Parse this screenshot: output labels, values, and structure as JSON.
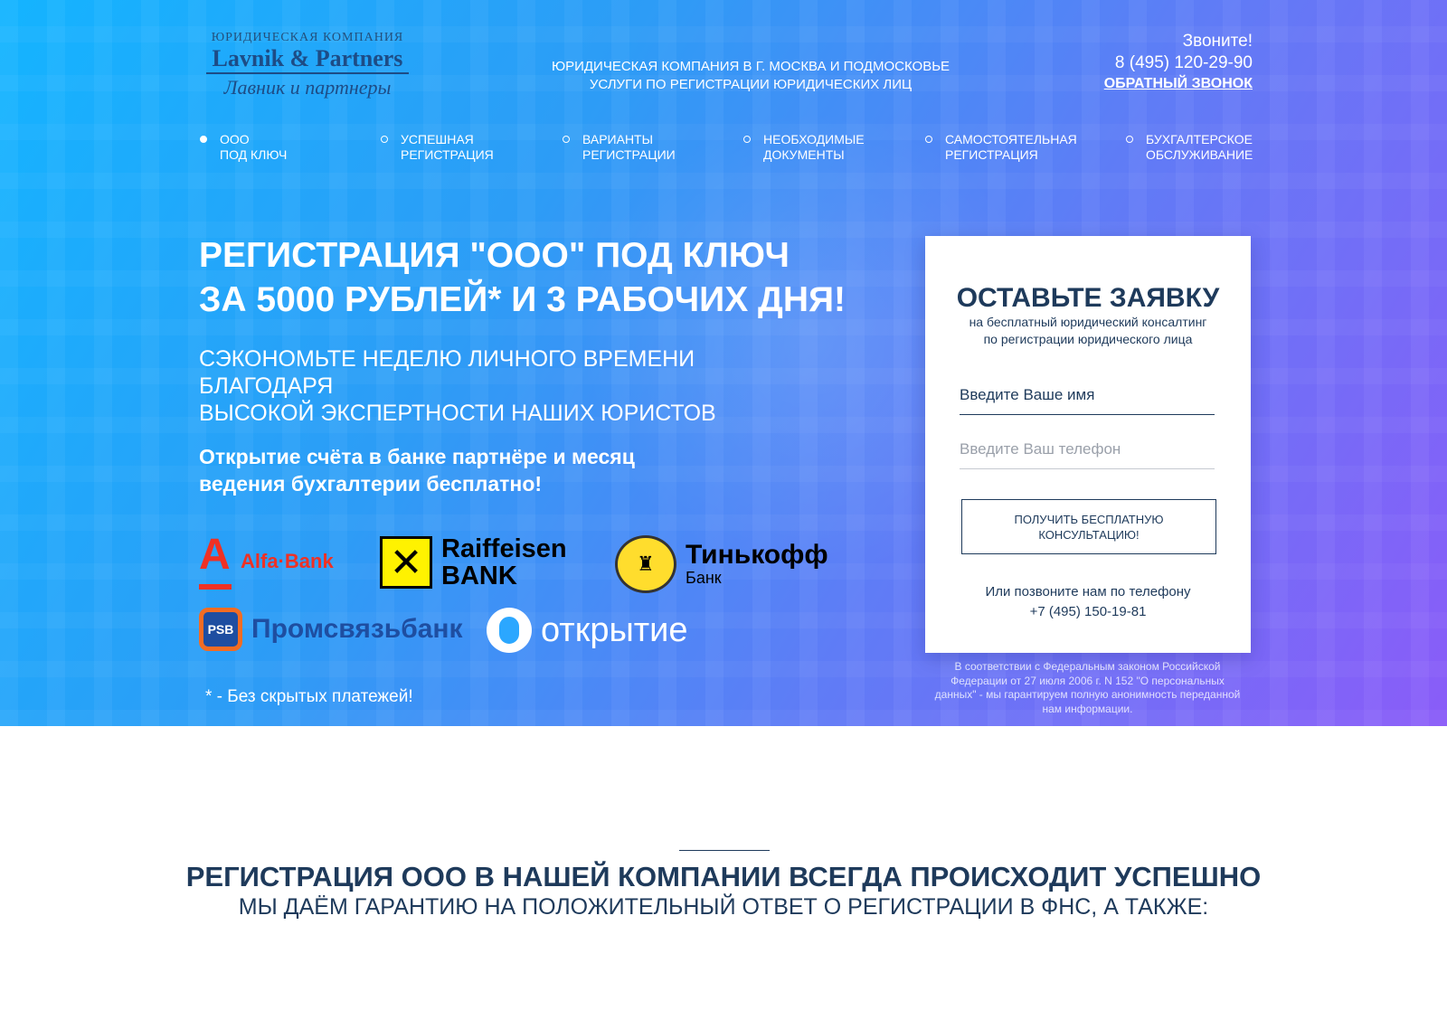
{
  "header": {
    "logo": {
      "top": "ЮРИДИЧЕСКАЯ КОМПАНИЯ",
      "main": "Lavnik & Partners",
      "sub": "Лавник и партнеры"
    },
    "tagline_1": "ЮРИДИЧЕСКАЯ КОМПАНИЯ В Г. МОСКВА И ПОДМОСКОВЬЕ",
    "tagline_2": "УСЛУГИ ПО РЕГИСТРАЦИИ ЮРИДИЧЕСКИХ ЛИЦ",
    "contact": {
      "call": "Звоните!",
      "phone": "8 (495) 120-29-90",
      "callback": "ОБРАТНЫЙ ЗВОНОК"
    }
  },
  "nav": {
    "items": [
      {
        "line1": "ООО",
        "line2": "ПОД КЛЮЧ",
        "active": true
      },
      {
        "line1": "УСПЕШНАЯ",
        "line2": "РЕГИСТРАЦИЯ",
        "active": false
      },
      {
        "line1": "ВАРИАНТЫ",
        "line2": "РЕГИСТРАЦИИ",
        "active": false
      },
      {
        "line1": "НЕОБХОДИМЫЕ",
        "line2": "ДОКУМЕНТЫ",
        "active": false
      },
      {
        "line1": "САМОСТОЯТЕЛЬНАЯ",
        "line2": "РЕГИСТРАЦИЯ",
        "active": false
      },
      {
        "line1": "БУХГАЛТЕРСКОЕ",
        "line2": "ОБСЛУЖИВАНИЕ",
        "active": false
      }
    ]
  },
  "hero": {
    "title_1": "РЕГИСТРАЦИЯ \"ООО\" ПОД КЛЮЧ",
    "title_2": "ЗА 5000 РУБЛЕЙ* И 3 РАБОЧИХ ДНЯ!",
    "subtitle_1": "СЭКОНОМЬТЕ НЕДЕЛЮ ЛИЧНОГО ВРЕМЕНИ БЛАГОДАРЯ",
    "subtitle_2": "ВЫСОКОЙ ЭКСПЕРТНОСТИ НАШИХ ЮРИСТОВ",
    "offer_1": "Открытие счёта в банке партнёре и месяц",
    "offer_2": "ведения бухгалтерии бесплатно!",
    "footnote": "* - Без скрытых платежей!"
  },
  "banks": {
    "alfa": {
      "mark": "А",
      "name": "Alfa·Bank",
      "color": "#ef3124"
    },
    "raiffeisen": {
      "name_1": "Raiffeisen",
      "name_2": "BANK",
      "color": "#fff200"
    },
    "tinkoff": {
      "name": "Тинькофф",
      "sub": "Банк",
      "color": "#ffdd2d"
    },
    "psb": {
      "mark": "PSB",
      "name": "Промсвязьбанк",
      "color": "#1e4ea1"
    },
    "otkritie": {
      "name": "открытие",
      "color": "#ffffff"
    }
  },
  "form": {
    "title": "ОСТАВЬТЕ ЗАЯВКУ",
    "subtitle_1": "на бесплатный юридический консалтинг",
    "subtitle_2": "по регистрации юридического лица",
    "name_placeholder": "Введите Ваше имя",
    "phone_placeholder": "Введите Ваш телефон",
    "submit_1": "ПОЛУЧИТЬ БЕСПЛАТНУЮ",
    "submit_2": "КОНСУЛЬТАЦИЮ!",
    "call_text": "Или позвоните нам по телефону",
    "call_phone": "+7 (495) 150-19-81",
    "legal": "В соответствии с Федеральным законом Российской Федерации от 27 июля 2006 г. N 152 \"О персональных данных\" - мы гарантируем полную анонимность переданной нам информации."
  },
  "section": {
    "title": "РЕГИСТРАЦИЯ ООО В НАШЕЙ КОМПАНИИ ВСЕГДА ПРОИСХОДИТ УСПЕШНО",
    "subtitle": "МЫ ДАЁМ ГАРАНТИЮ НА ПОЛОЖИТЕЛЬНЫЙ ОТВЕТ О РЕГИСТРАЦИИ В ФНС, А ТАКЖЕ:"
  },
  "colors": {
    "primary": "#1e3a5b",
    "hero_start": "#14b4ff",
    "hero_end": "#8a5cf8"
  }
}
